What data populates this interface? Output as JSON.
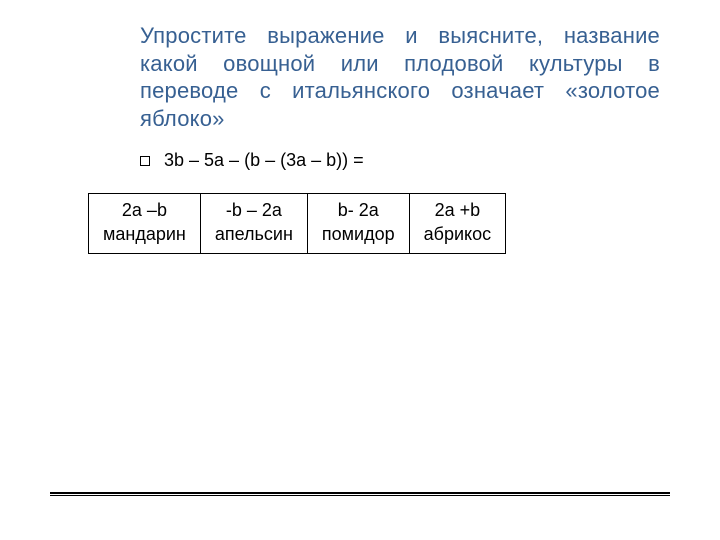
{
  "title": "Упростите выражение и выясните, название какой овощной или плодовой культуры в переводе с итальянского означает «золотое яблоко»",
  "expression": "3b – 5а – (b – (3a – b)) =",
  "answers": [
    {
      "top": "2a –b",
      "bottom": "мандарин"
    },
    {
      "top": "-b – 2a",
      "bottom": "апельсин"
    },
    {
      "top": "b- 2a",
      "bottom": "помидор"
    },
    {
      "top": "2a +b",
      "bottom": "абрикос"
    }
  ]
}
